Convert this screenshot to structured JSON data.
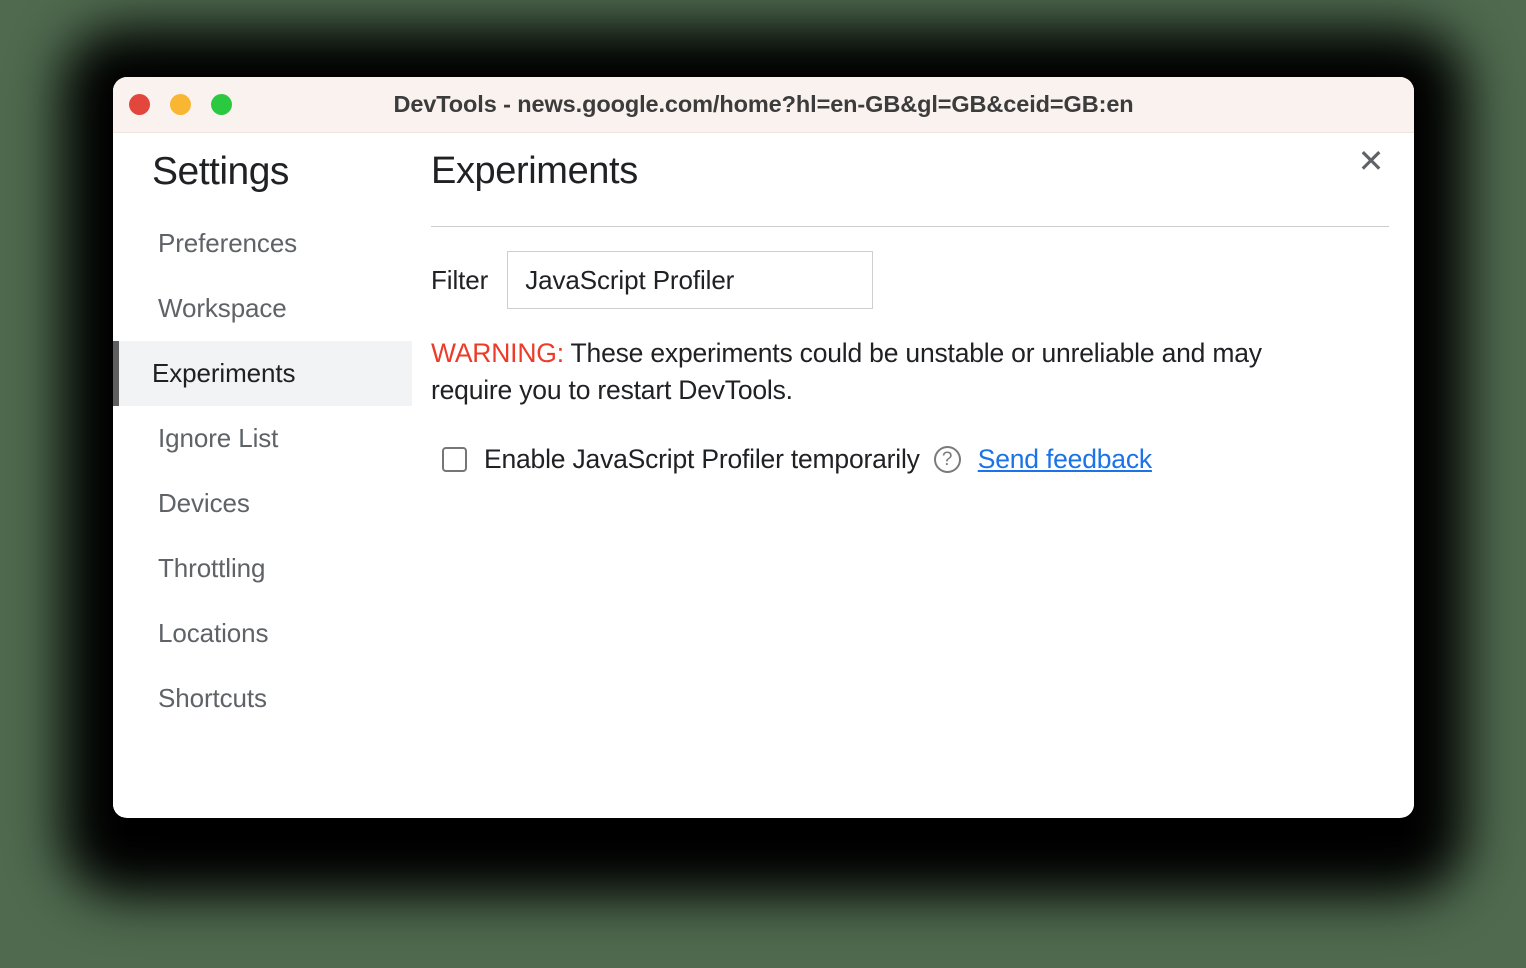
{
  "window": {
    "title": "DevTools - news.google.com/home?hl=en-GB&gl=GB&ceid=GB:en",
    "traffic_lights": [
      {
        "name": "close",
        "color": "#e2463c"
      },
      {
        "name": "minimize",
        "color": "#f8b633"
      },
      {
        "name": "maximize",
        "color": "#2bc940"
      }
    ],
    "titlebar_bg": "#faf2ef",
    "backdrop_color": "#4f6a4f"
  },
  "sidebar": {
    "heading": "Settings",
    "items": [
      {
        "label": "Preferences",
        "selected": false
      },
      {
        "label": "Workspace",
        "selected": false
      },
      {
        "label": "Experiments",
        "selected": true
      },
      {
        "label": "Ignore List",
        "selected": false
      },
      {
        "label": "Devices",
        "selected": false
      },
      {
        "label": "Throttling",
        "selected": false
      },
      {
        "label": "Locations",
        "selected": false
      },
      {
        "label": "Shortcuts",
        "selected": false
      }
    ],
    "selected_accent": "#5f5f5f",
    "selected_bg": "#f1f3f4"
  },
  "main": {
    "heading": "Experiments",
    "close_icon": "close-icon",
    "close_glyph": "✕",
    "filter": {
      "label": "Filter",
      "value": "JavaScript Profiler",
      "placeholder": "Filter"
    },
    "warning": {
      "keyword": "WARNING:",
      "keyword_color": "#ec3b28",
      "text": " These experiments could be unstable or unreliable and may require you to restart DevTools."
    },
    "experiments": [
      {
        "label": "Enable JavaScript Profiler temporarily",
        "checked": false,
        "help_icon": "help-circle-icon",
        "help_glyph": "?",
        "link_label": "Send feedback",
        "link_color": "#1a73e8"
      }
    ]
  }
}
